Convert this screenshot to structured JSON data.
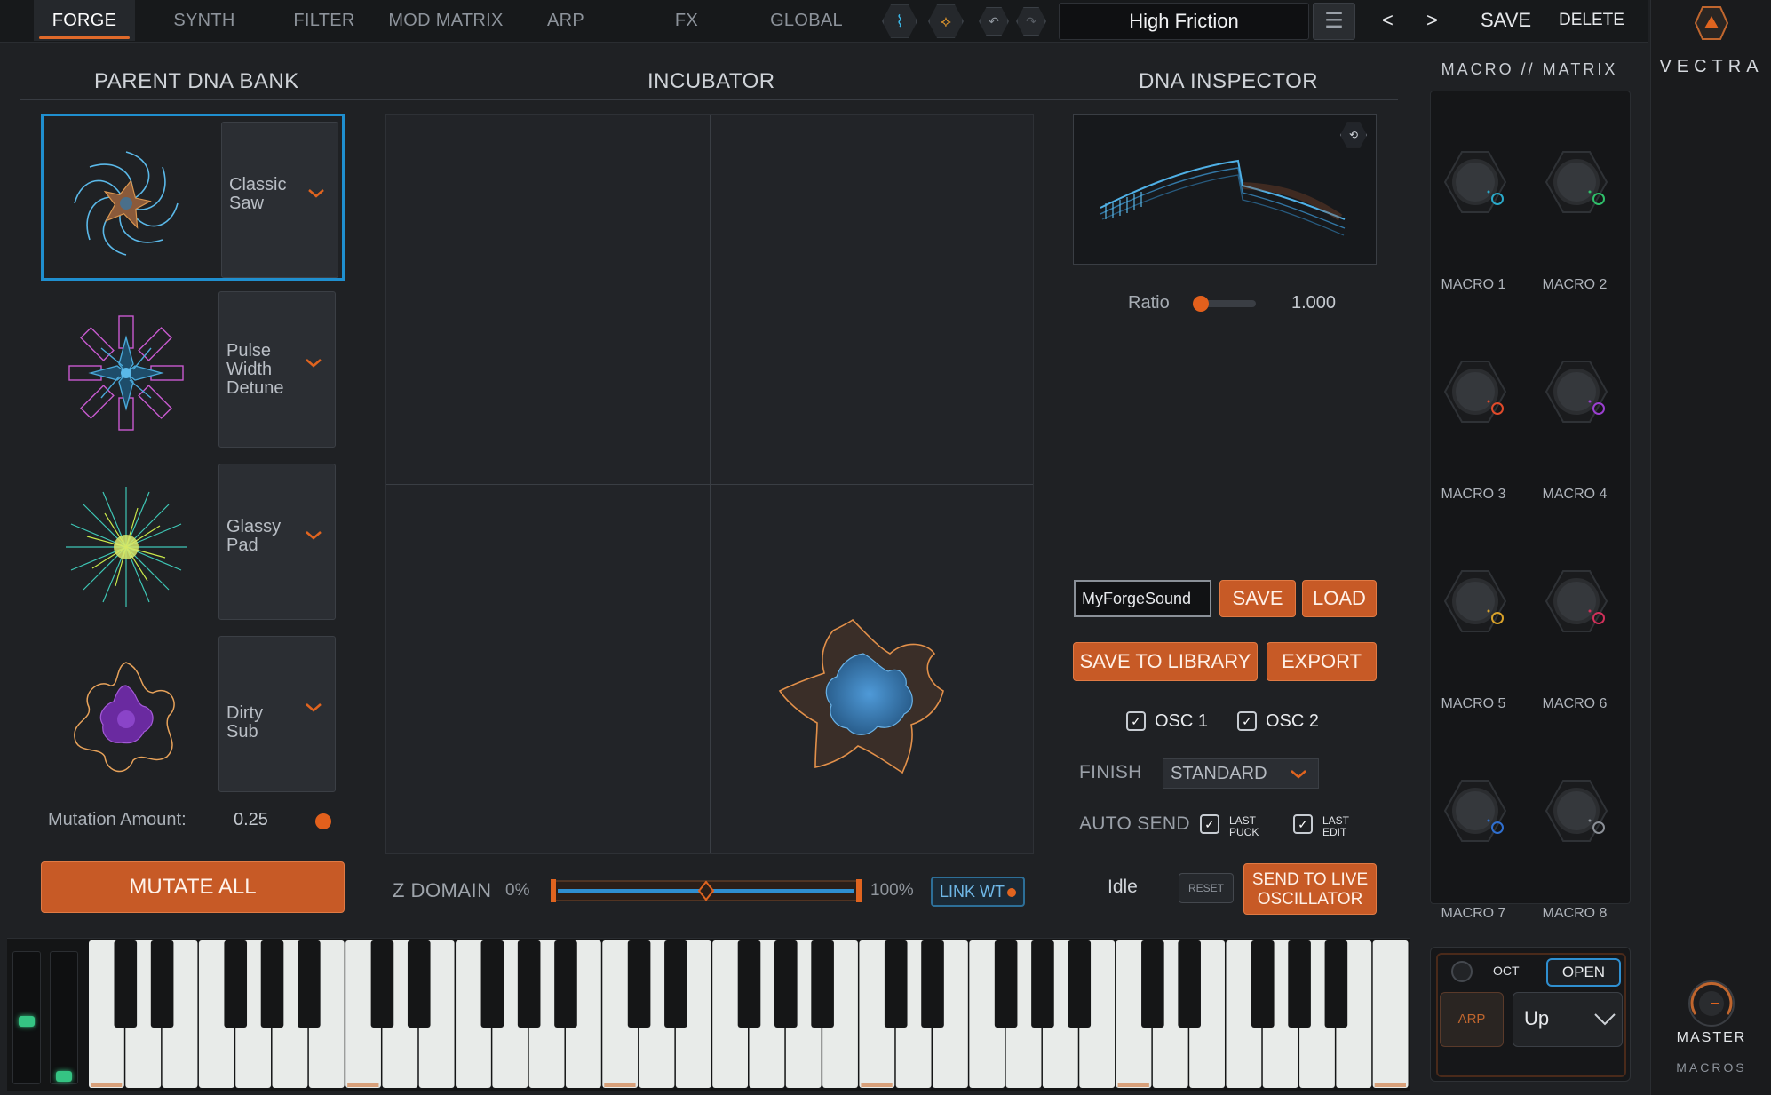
{
  "tabs": [
    "FORGE",
    "SYNTH",
    "FILTER",
    "MOD MATRIX",
    "ARP",
    "FX",
    "GLOBAL"
  ],
  "active_tab": "FORGE",
  "preset_name": "High Friction",
  "nav": {
    "prev": "<",
    "next": ">",
    "save": "SAVE",
    "delete": "DELETE"
  },
  "sections": {
    "bank": "PARENT DNA BANK",
    "incubator": "INCUBATOR",
    "inspector": "DNA INSPECTOR"
  },
  "parents": [
    {
      "name": "Classic Saw",
      "selected": true
    },
    {
      "name": "Pulse Width Detune",
      "selected": false
    },
    {
      "name": "Glassy Pad",
      "selected": false
    },
    {
      "name": "Dirty Sub",
      "selected": false
    }
  ],
  "mutation": {
    "label": "Mutation Amount:",
    "value": "0.25"
  },
  "mutate_all": "MUTATE ALL",
  "zdomain": {
    "label": "Z DOMAIN",
    "min": "0%",
    "max": "100%",
    "position": 0.5,
    "link": "LINK WT"
  },
  "inspector": {
    "ratio_label": "Ratio",
    "ratio_value": "1.000",
    "sound_name": "MyForgeSound",
    "save": "SAVE",
    "load": "LOAD",
    "save_library": "SAVE TO LIBRARY",
    "export": "EXPORT",
    "osc1": "OSC 1",
    "osc2": "OSC 2",
    "finish_label": "FINISH",
    "finish_value": "STANDARD",
    "auto_send": "AUTO SEND",
    "last_puck_1": "LAST",
    "last_puck_2": "PUCK",
    "last_edit_1": "LAST",
    "last_edit_2": "EDIT",
    "status": "Idle",
    "reset": "RESET",
    "send_1": "SEND TO LIVE",
    "send_2": "OSCILLATOR"
  },
  "macro": {
    "title": "MACRO // MATRIX",
    "knobs": [
      {
        "label": "MACRO 1",
        "color": "#2aa9c9"
      },
      {
        "label": "MACRO 2",
        "color": "#2fbf6a"
      },
      {
        "label": "MACRO 3",
        "color": "#e04a2a"
      },
      {
        "label": "MACRO 4",
        "color": "#9a3fd0"
      },
      {
        "label": "MACRO 5",
        "color": "#d9a22a"
      },
      {
        "label": "MACRO 6",
        "color": "#d0305a"
      },
      {
        "label": "MACRO 7",
        "color": "#2f6fd0"
      },
      {
        "label": "MACRO 8",
        "color": "#8a8f96"
      }
    ]
  },
  "brand": "VECTRA",
  "master": "MASTER",
  "macros_label": "MACROS",
  "arp": {
    "oct": "OCT",
    "open": "OPEN",
    "arp": "ARP",
    "mode": "Up"
  },
  "colors": {
    "accent": "#c75a26",
    "select": "#1f8fcf",
    "bg": "#1f2124"
  }
}
